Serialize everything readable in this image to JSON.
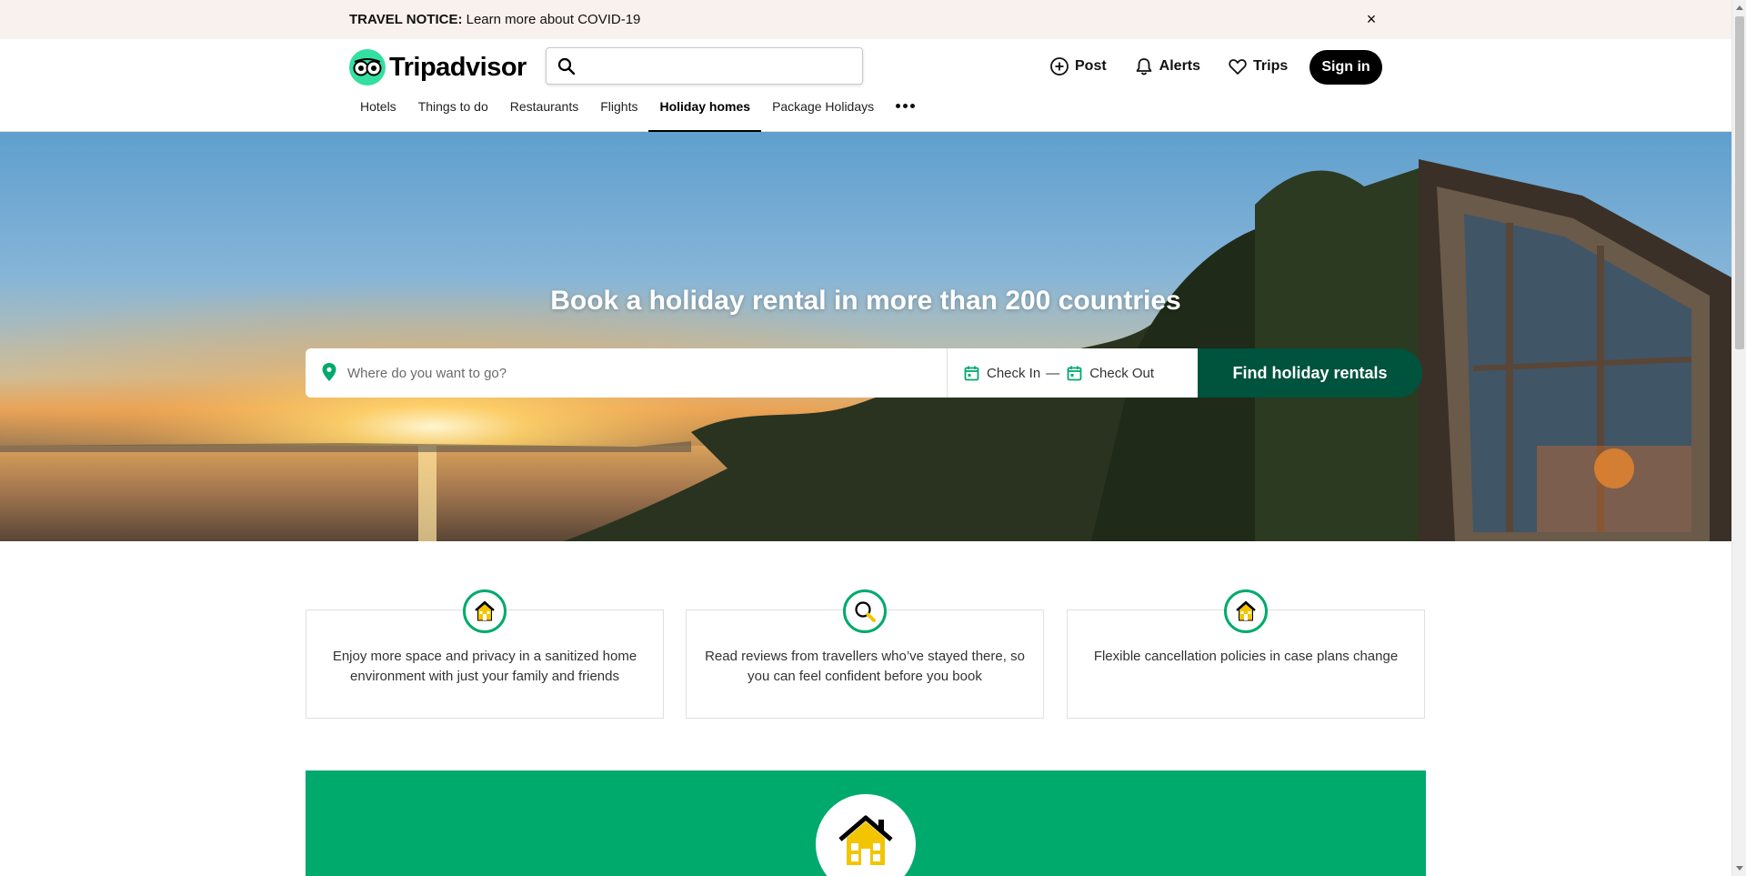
{
  "notice": {
    "label": "TRAVEL NOTICE:",
    "text": " Learn more about COVID-19",
    "close_label": "×"
  },
  "header": {
    "logo_text": "Tripadvisor",
    "search_placeholder": "",
    "actions": [
      {
        "label": "Post",
        "icon": "plus-circle-icon"
      },
      {
        "label": "Alerts",
        "icon": "bell-icon"
      },
      {
        "label": "Trips",
        "icon": "heart-icon"
      }
    ],
    "signin_label": "Sign in"
  },
  "nav": {
    "items": [
      {
        "label": "Hotels"
      },
      {
        "label": "Things to do"
      },
      {
        "label": "Restaurants"
      },
      {
        "label": "Flights"
      },
      {
        "label": "Holiday homes",
        "active": true
      },
      {
        "label": "Package Holidays"
      }
    ],
    "more_icon": "more-dots-icon"
  },
  "hero": {
    "title": "Book a holiday rental in more than 200 countries",
    "where_placeholder": "Where do you want to go?",
    "check_in_label": "Check In",
    "date_separator": "—",
    "check_out_label": "Check Out",
    "find_button_label": "Find holiday rentals"
  },
  "features": [
    {
      "icon": "house-icon",
      "text": "Enjoy more space and privacy in a sanitized home environment with just your family and friends"
    },
    {
      "icon": "magnifier-icon",
      "text": "Read reviews from travellers who’ve stayed there, so you can feel confident before you book"
    },
    {
      "icon": "house-icon",
      "text": "Flexible cancellation policies in case plans change"
    }
  ],
  "colors": {
    "brand_green": "#00aa6c",
    "dark_green": "#00533d",
    "logo_green": "#34e0a1",
    "notice_bg": "#f9f1ee",
    "house_yellow": "#f2c500"
  }
}
